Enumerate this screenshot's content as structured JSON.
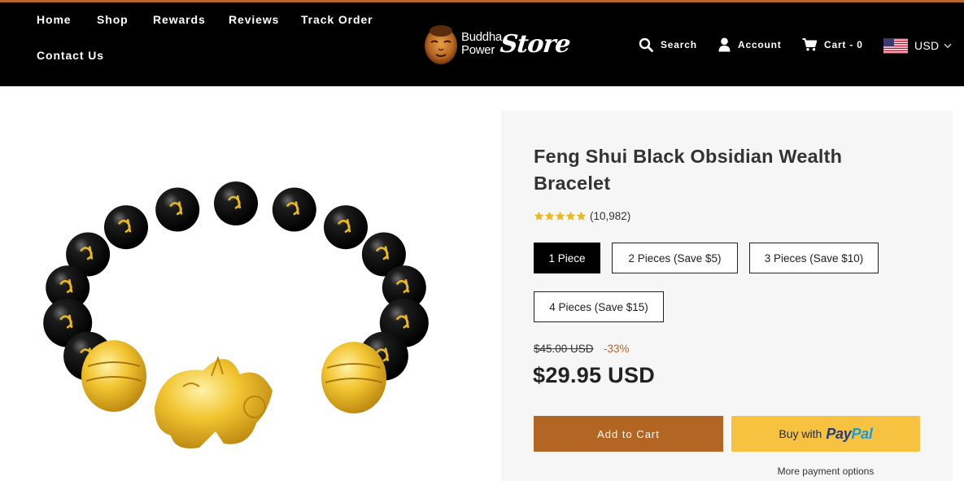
{
  "header": {
    "nav": [
      "Home",
      "Shop",
      "Rewards",
      "Reviews",
      "Track Order",
      "Contact Us"
    ],
    "logo": {
      "line1": "Buddha",
      "line2": "Power",
      "script": "Store"
    },
    "search_label": "Search",
    "account_label": "Account",
    "cart_label": "Cart - 0",
    "currency": "USD"
  },
  "product": {
    "title": "Feng Shui Black Obsidian Wealth Bracelet",
    "rating_stars": 5,
    "review_count": "(10,982)",
    "variants": [
      {
        "label": "1 Piece",
        "selected": true
      },
      {
        "label": "2 Pieces (Save $5)",
        "selected": false
      },
      {
        "label": "3 Pieces (Save $10)",
        "selected": false
      },
      {
        "label": "4 Pieces (Save $15)",
        "selected": false
      }
    ],
    "compare_price": "$45.00 USD",
    "discount": "-33%",
    "price": "$29.95 USD",
    "add_to_cart": "Add to Cart",
    "paypal": {
      "prefix": "Buy with",
      "brand1": "Pay",
      "brand2": "Pal"
    },
    "more_payment": "More payment options"
  },
  "colors": {
    "header_bg": "#000000",
    "accent": "#b36523",
    "paypal_yellow": "#f7c23f",
    "star_gold": "#e8b923"
  }
}
